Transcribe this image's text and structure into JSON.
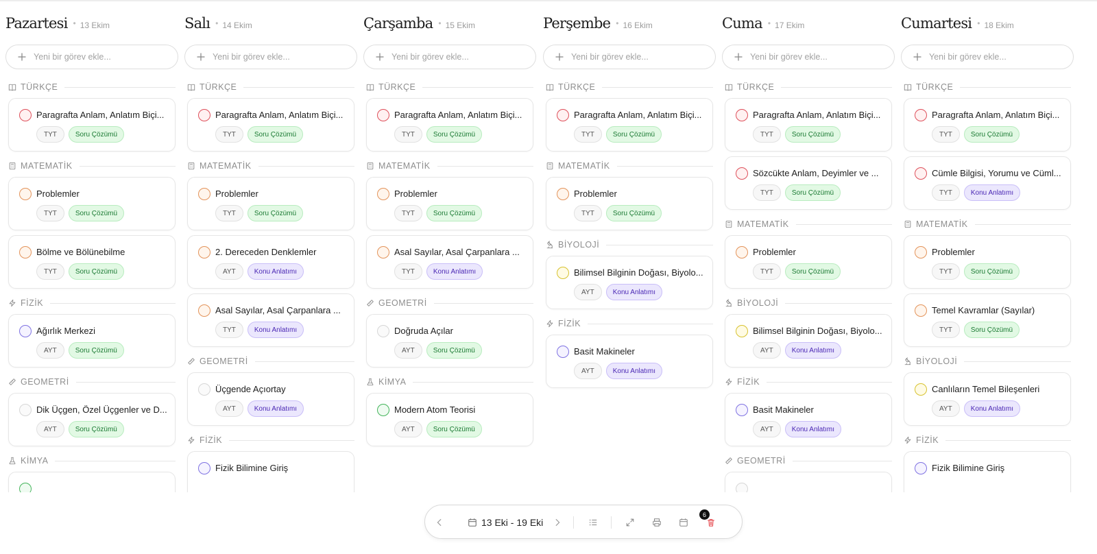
{
  "add_placeholder": "Yeni bir görev ekle...",
  "days": [
    {
      "name": "Pazartesi",
      "date": "13 Ekim",
      "sections": [
        {
          "label": "TÜRKÇE",
          "icon": "book-icon",
          "tasks": [
            {
              "title": "Paragrafta Anlam, Anlatım Biçi...",
              "level": "TYT",
              "type": "Soru Çözümü",
              "status": "red"
            }
          ]
        },
        {
          "label": "MATEMATİK",
          "icon": "calculator-icon",
          "tasks": [
            {
              "title": "Problemler",
              "level": "TYT",
              "type": "Soru Çözümü",
              "status": "orange"
            },
            {
              "title": "Bölme ve Bölünebilme",
              "level": "TYT",
              "type": "Soru Çözümü",
              "status": "orange"
            }
          ]
        },
        {
          "label": "FİZİK",
          "icon": "zap-icon",
          "tasks": [
            {
              "title": "Ağırlık Merkezi",
              "level": "AYT",
              "type": "Soru Çözümü",
              "status": "purple"
            }
          ]
        },
        {
          "label": "GEOMETRİ",
          "icon": "ruler-icon",
          "tasks": [
            {
              "title": "Dik Üçgen, Özel Üçgenler ve D...",
              "level": "AYT",
              "type": "Soru Çözümü",
              "status": "gray"
            }
          ]
        },
        {
          "label": "KİMYA",
          "icon": "flask-icon",
          "tasks": [
            {
              "title": "",
              "level": "",
              "type": "",
              "status": "green"
            }
          ]
        }
      ]
    },
    {
      "name": "Salı",
      "date": "14 Ekim",
      "sections": [
        {
          "label": "TÜRKÇE",
          "icon": "book-icon",
          "tasks": [
            {
              "title": "Paragrafta Anlam, Anlatım Biçi...",
              "level": "TYT",
              "type": "Soru Çözümü",
              "status": "red"
            }
          ]
        },
        {
          "label": "MATEMATİK",
          "icon": "calculator-icon",
          "tasks": [
            {
              "title": "Problemler",
              "level": "TYT",
              "type": "Soru Çözümü",
              "status": "orange"
            },
            {
              "title": "2. Dereceden Denklemler",
              "level": "AYT",
              "type": "Konu Anlatımı",
              "status": "orange"
            },
            {
              "title": "Asal Sayılar, Asal Çarpanlara ...",
              "level": "TYT",
              "type": "Konu Anlatımı",
              "status": "orange"
            }
          ]
        },
        {
          "label": "GEOMETRİ",
          "icon": "ruler-icon",
          "tasks": [
            {
              "title": "Üçgende Açıortay",
              "level": "AYT",
              "type": "Konu Anlatımı",
              "status": "gray"
            }
          ]
        },
        {
          "label": "FİZİK",
          "icon": "zap-icon",
          "tasks": [
            {
              "title": "Fizik Bilimine Giriş",
              "level": "",
              "type": "",
              "status": "purple"
            }
          ]
        }
      ]
    },
    {
      "name": "Çarşamba",
      "date": "15 Ekim",
      "sections": [
        {
          "label": "TÜRKÇE",
          "icon": "book-icon",
          "tasks": [
            {
              "title": "Paragrafta Anlam, Anlatım Biçi...",
              "level": "TYT",
              "type": "Soru Çözümü",
              "status": "red"
            }
          ]
        },
        {
          "label": "MATEMATİK",
          "icon": "calculator-icon",
          "tasks": [
            {
              "title": "Problemler",
              "level": "TYT",
              "type": "Soru Çözümü",
              "status": "orange"
            },
            {
              "title": "Asal Sayılar, Asal Çarpanlara ...",
              "level": "TYT",
              "type": "Konu Anlatımı",
              "status": "orange"
            }
          ]
        },
        {
          "label": "GEOMETRİ",
          "icon": "ruler-icon",
          "tasks": [
            {
              "title": "Doğruda Açılar",
              "level": "AYT",
              "type": "Soru Çözümü",
              "status": "gray"
            }
          ]
        },
        {
          "label": "KİMYA",
          "icon": "flask-icon",
          "tasks": [
            {
              "title": "Modern Atom Teorisi",
              "level": "AYT",
              "type": "Soru Çözümü",
              "status": "green"
            }
          ]
        }
      ]
    },
    {
      "name": "Perşembe",
      "date": "16 Ekim",
      "sections": [
        {
          "label": "TÜRKÇE",
          "icon": "book-icon",
          "tasks": [
            {
              "title": "Paragrafta Anlam, Anlatım Biçi...",
              "level": "TYT",
              "type": "Soru Çözümü",
              "status": "red"
            }
          ]
        },
        {
          "label": "MATEMATİK",
          "icon": "calculator-icon",
          "tasks": [
            {
              "title": "Problemler",
              "level": "TYT",
              "type": "Soru Çözümü",
              "status": "orange"
            }
          ]
        },
        {
          "label": "BİYOLOJİ",
          "icon": "microscope-icon",
          "tasks": [
            {
              "title": "Bilimsel Bilginin Doğası, Biyolo...",
              "level": "AYT",
              "type": "Konu Anlatımı",
              "status": "yellow"
            }
          ]
        },
        {
          "label": "FİZİK",
          "icon": "zap-icon",
          "tasks": [
            {
              "title": "Basit Makineler",
              "level": "AYT",
              "type": "Konu Anlatımı",
              "status": "purple"
            }
          ]
        }
      ]
    },
    {
      "name": "Cuma",
      "date": "17 Ekim",
      "sections": [
        {
          "label": "TÜRKÇE",
          "icon": "book-icon",
          "tasks": [
            {
              "title": "Paragrafta Anlam, Anlatım Biçi...",
              "level": "TYT",
              "type": "Soru Çözümü",
              "status": "red"
            },
            {
              "title": "Sözcükte Anlam, Deyimler ve ...",
              "level": "TYT",
              "type": "Soru Çözümü",
              "status": "red"
            }
          ]
        },
        {
          "label": "MATEMATİK",
          "icon": "calculator-icon",
          "tasks": [
            {
              "title": "Problemler",
              "level": "TYT",
              "type": "Soru Çözümü",
              "status": "orange"
            }
          ]
        },
        {
          "label": "BİYOLOJİ",
          "icon": "microscope-icon",
          "tasks": [
            {
              "title": "Bilimsel Bilginin Doğası, Biyolo...",
              "level": "AYT",
              "type": "Konu Anlatımı",
              "status": "yellow"
            }
          ]
        },
        {
          "label": "FİZİK",
          "icon": "zap-icon",
          "tasks": [
            {
              "title": "Basit Makineler",
              "level": "AYT",
              "type": "Konu Anlatımı",
              "status": "purple"
            }
          ]
        },
        {
          "label": "GEOMETRİ",
          "icon": "ruler-icon",
          "tasks": [
            {
              "title": "",
              "level": "",
              "type": "",
              "status": "gray"
            }
          ]
        }
      ]
    },
    {
      "name": "Cumartesi",
      "date": "18 Ekim",
      "sections": [
        {
          "label": "TÜRKÇE",
          "icon": "book-icon",
          "tasks": [
            {
              "title": "Paragrafta Anlam, Anlatım Biçi...",
              "level": "TYT",
              "type": "Soru Çözümü",
              "status": "red"
            },
            {
              "title": "Cümle Bilgisi, Yorumu ve Cüml...",
              "level": "TYT",
              "type": "Konu Anlatımı",
              "status": "red"
            }
          ]
        },
        {
          "label": "MATEMATİK",
          "icon": "calculator-icon",
          "tasks": [
            {
              "title": "Problemler",
              "level": "TYT",
              "type": "Soru Çözümü",
              "status": "orange"
            },
            {
              "title": "Temel Kavramlar (Sayılar)",
              "level": "TYT",
              "type": "Soru Çözümü",
              "status": "orange"
            }
          ]
        },
        {
          "label": "BİYOLOJİ",
          "icon": "microscope-icon",
          "tasks": [
            {
              "title": "Canlıların Temel Bileşenleri",
              "level": "AYT",
              "type": "Konu Anlatımı",
              "status": "yellow"
            }
          ]
        },
        {
          "label": "FİZİK",
          "icon": "zap-icon",
          "tasks": [
            {
              "title": "Fizik Bilimine Giriş",
              "level": "",
              "type": "",
              "status": "purple"
            }
          ]
        }
      ]
    }
  ],
  "toolbar": {
    "range": "13 Eki - 19 Eki",
    "badge_count": "6",
    "icons": [
      "chevron-left-icon",
      "calendar-icon",
      "chevron-right-icon",
      "list-icon",
      "expand-icon",
      "printer-icon",
      "calendar-icon",
      "trash-icon"
    ],
    "delete_color": "#e5484d"
  }
}
